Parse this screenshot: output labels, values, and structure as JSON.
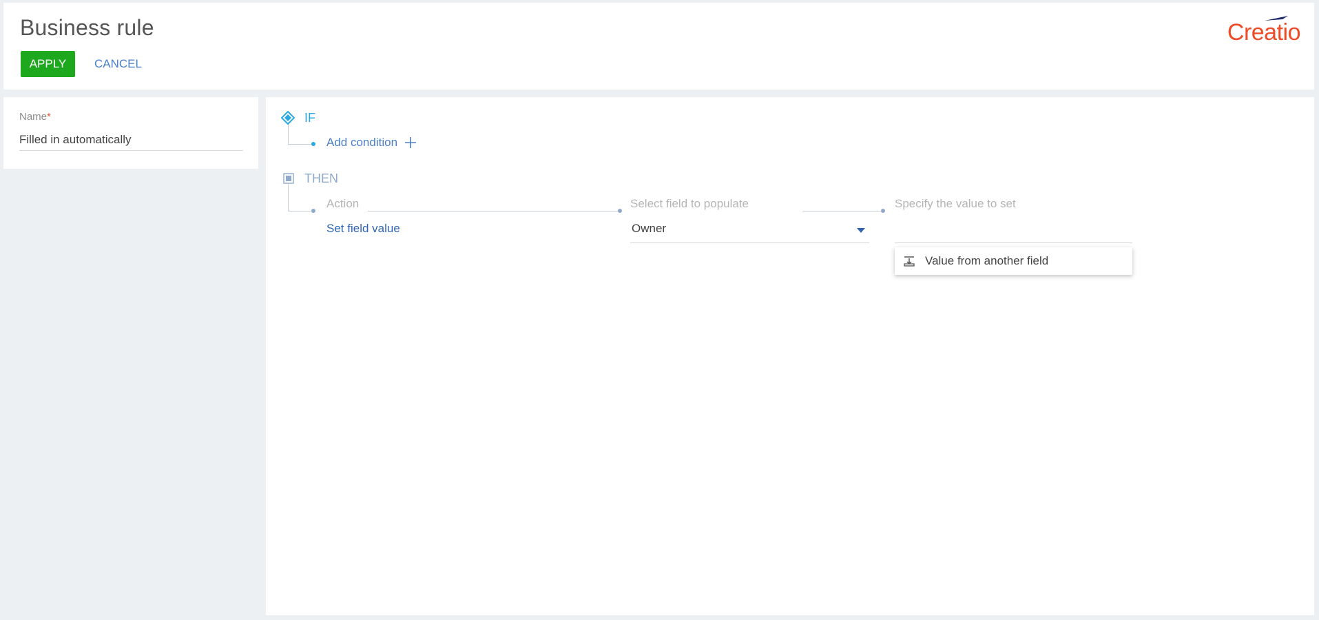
{
  "header": {
    "title": "Business rule",
    "apply_label": "APPLY",
    "cancel_label": "CANCEL",
    "logo_text": "Creatio"
  },
  "name_field": {
    "label": "Name",
    "required_mark": "*",
    "value": "Filled in automatically"
  },
  "rule": {
    "if_label": "IF",
    "add_condition_label": "Add condition",
    "then_label": "THEN",
    "columns": {
      "action": "Action",
      "field": "Select field to populate",
      "value": "Specify the value to set"
    },
    "action_value": "Set field value",
    "field_value": "Owner",
    "value_input": ""
  },
  "dropdown": {
    "items": [
      {
        "label": "Value from another field",
        "icon": "field-source-icon"
      }
    ]
  },
  "colors": {
    "accent_green": "#1ea81e",
    "link_blue": "#4b7fc7",
    "if_blue": "#2aa9e0",
    "logo_orange": "#ee4b26"
  }
}
